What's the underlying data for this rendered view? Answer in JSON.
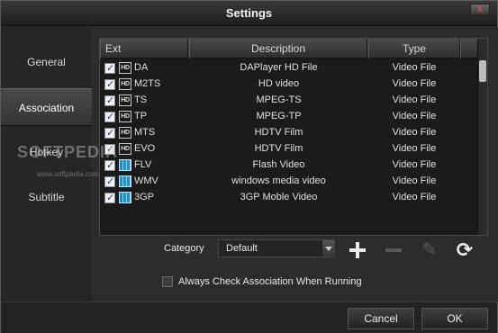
{
  "window": {
    "title": "Settings",
    "close_label": "x"
  },
  "sidebar": {
    "items": [
      {
        "label": "General"
      },
      {
        "label": "Association"
      },
      {
        "label": "Hotkey"
      },
      {
        "label": "Subtitle"
      }
    ],
    "active": "Association"
  },
  "table": {
    "columns": [
      "Ext",
      "Description",
      "Type"
    ],
    "rows": [
      {
        "ext": "DA",
        "description": "DAPlayer HD File",
        "type": "Video File",
        "checked": true,
        "icon": "hd-icon"
      },
      {
        "ext": "M2TS",
        "description": "HD video",
        "type": "Video File",
        "checked": true,
        "icon": "hd-icon"
      },
      {
        "ext": "TS",
        "description": "MPEG-TS",
        "type": "Video File",
        "checked": true,
        "icon": "hd-icon"
      },
      {
        "ext": "TP",
        "description": "MPEG-TP",
        "type": "Video File",
        "checked": true,
        "icon": "hd-icon"
      },
      {
        "ext": "MTS",
        "description": "HDTV Film",
        "type": "Video File",
        "checked": true,
        "icon": "hd-icon"
      },
      {
        "ext": "EVO",
        "description": "HDTV Film",
        "type": "Video File",
        "checked": true,
        "icon": "hd-icon"
      },
      {
        "ext": "FLV",
        "description": "Flash Video",
        "type": "Video File",
        "checked": true,
        "icon": "film-icon"
      },
      {
        "ext": "WMV",
        "description": "windows media video",
        "type": "Video File",
        "checked": true,
        "icon": "film-icon"
      },
      {
        "ext": "3GP",
        "description": "3GP Moble Video",
        "type": "Video File",
        "checked": true,
        "icon": "film-icon"
      }
    ],
    "hd_icon_text": "HD"
  },
  "category": {
    "label": "Category",
    "value": "Default"
  },
  "toolbar_icons": [
    "add-icon",
    "remove-icon",
    "edit-icon",
    "refresh-icon"
  ],
  "options": {
    "always_check_label": "Always Check Association When Running",
    "always_check": false
  },
  "buttons": {
    "cancel": "Cancel",
    "ok": "OK"
  },
  "watermark": {
    "logo": "SOFTPEDIA",
    "url": "www.softpedia.com"
  }
}
